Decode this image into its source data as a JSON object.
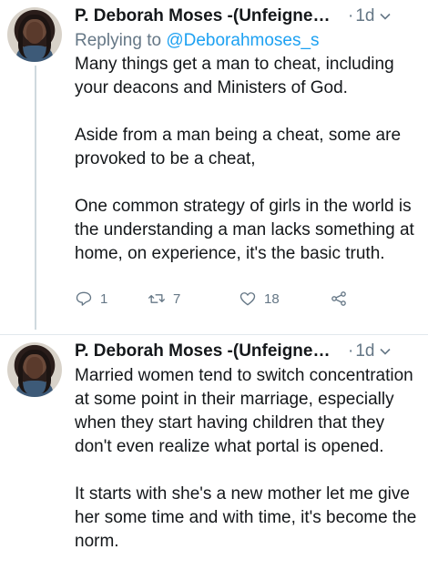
{
  "tweets": [
    {
      "author": "P. Deborah Moses -(Unfeigned ...",
      "dot": "·",
      "time": "1d",
      "reply_prefix": "Replying to",
      "reply_handle": "@Deborahmoses_s",
      "paragraphs": [
        "Many things get a man to cheat, including your deacons and Ministers of God.",
        "Aside from a man being a cheat, some are provoked to be a cheat,",
        "One common strategy of girls in the world is the understanding a man lacks something at home, on experience, it's the basic truth."
      ],
      "reply_count": "1",
      "retweet_count": "7",
      "like_count": "18"
    },
    {
      "author": "P. Deborah Moses -(Unfeigned ...",
      "dot": "·",
      "time": "1d",
      "paragraphs": [
        "Married women tend to switch concentration at some point in their marriage, especially when they start having children that they don't even realize what portal is opened.",
        "It starts with she's a new mother let me give her some time and with time, it's become the norm."
      ]
    }
  ],
  "icons": {
    "reply": "reply-icon",
    "retweet": "retweet-icon",
    "like": "heart-icon",
    "share": "share-icon",
    "menu": "chevron-down-icon"
  },
  "colors": {
    "text": "#14171a",
    "secondary": "#657786",
    "link": "#1da1f2",
    "thread_line": "#cfd9de"
  }
}
